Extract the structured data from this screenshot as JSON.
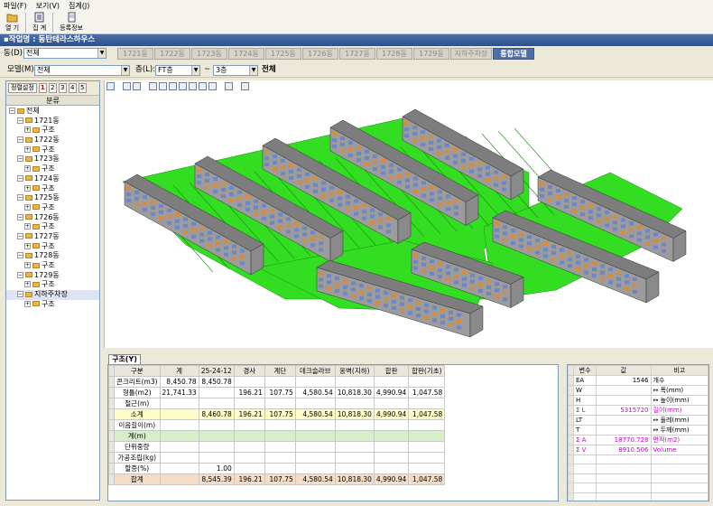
{
  "menu": {
    "file": "파일(F)",
    "view": "보기(V)",
    "sum": "집계(J)"
  },
  "toolbar": {
    "open": "열 기",
    "sum": "집 계",
    "register": "등록정보"
  },
  "title": "▪작업명 : 동탄테라스하우스",
  "dong": {
    "label": "동(D):",
    "value": "전체"
  },
  "tabs": [
    "1721동",
    "1722동",
    "1723동",
    "1724동",
    "1725동",
    "1726동",
    "1727동",
    "1728동",
    "1729동",
    "지하주차장",
    "통합모델"
  ],
  "model": {
    "label": "모델(M):",
    "value": "전체"
  },
  "floor": {
    "label": "층(L):",
    "from": "FT층",
    "tilde": "~",
    "to": "3층",
    "all": "전체"
  },
  "left_panel": {
    "button": "정렬설정",
    "nums": [
      "1",
      "2",
      "3",
      "4",
      "5"
    ],
    "header": "분류",
    "root": "전체",
    "buildings": [
      "1721동",
      "1722동",
      "1723동",
      "1724동",
      "1725동",
      "1726동",
      "1727동",
      "1728동",
      "1729동",
      "지하주차장"
    ],
    "child": "구조"
  },
  "bottom_tab": "구조(Y)",
  "grid": {
    "headers": [
      "구분",
      "계",
      "25-24-12",
      "경사",
      "계단",
      "데크슬라브",
      "옹벽(지하)",
      "합판",
      "합판(기초)"
    ],
    "rows": [
      {
        "cells": [
          "콘크리트(m3)",
          "8,450.78",
          "8,450.78",
          "",
          "",
          "",
          "",
          "",
          ""
        ],
        "cls": ""
      },
      {
        "cells": [
          "형틀(m2)",
          "21,741.33",
          "",
          "196.21",
          "107.75",
          "4,580.54",
          "10,818.30",
          "4,990.94",
          "1,047.58"
        ],
        "cls": ""
      },
      {
        "cells": [
          "철근(m)",
          "",
          "",
          "",
          "",
          "",
          "",
          "",
          ""
        ],
        "cls": ""
      },
      {
        "cells": [
          "소계",
          "",
          "8,460.78",
          "196.21",
          "107.75",
          "4,580.54",
          "10,818.30",
          "4,990.94",
          "1,047.58"
        ],
        "cls": "sub"
      },
      {
        "cells": [
          "이음길이(m)",
          "",
          "",
          "",
          "",
          "",
          "",
          "",
          ""
        ],
        "cls": ""
      },
      {
        "cells": [
          "계(m)",
          "",
          "",
          "",
          "",
          "",
          "",
          "",
          ""
        ],
        "cls": "green"
      },
      {
        "cells": [
          "단위중량",
          "",
          "",
          "",
          "",
          "",
          "",
          "",
          ""
        ],
        "cls": ""
      },
      {
        "cells": [
          "가공조립(kg)",
          "",
          "",
          "",
          "",
          "",
          "",
          "",
          ""
        ],
        "cls": ""
      },
      {
        "cells": [
          "할증(%)",
          "",
          "1.00",
          "",
          "",
          "",
          "",
          "",
          ""
        ],
        "cls": ""
      },
      {
        "cells": [
          "합계",
          "",
          "8,545.39",
          "196.21",
          "107.75",
          "4,580.54",
          "10,818.30",
          "4,990.94",
          "1,047.58"
        ],
        "cls": "tot"
      }
    ]
  },
  "vars": {
    "headers": [
      "변수",
      "값",
      "비고"
    ],
    "rows": [
      {
        "k": "EA",
        "v": "1546",
        "n": "개수",
        "m": false
      },
      {
        "k": "W",
        "v": "",
        "n": "↔ 폭(mm)",
        "m": false
      },
      {
        "k": "H",
        "v": "",
        "n": "↔ 높이(mm)",
        "m": false
      },
      {
        "k": "Σ L",
        "v": "5315720",
        "n": "길이(mm)",
        "m": true
      },
      {
        "k": "LT",
        "v": "",
        "n": "↔ 둘레(mm)",
        "m": false
      },
      {
        "k": "T",
        "v": "",
        "n": "↔ 두께(mm)",
        "m": false
      },
      {
        "k": "Σ A",
        "v": "18770.728",
        "n": "면적(m2)",
        "m": true
      },
      {
        "k": "Σ V",
        "v": "8910.506",
        "n": "Volume",
        "m": true
      },
      {
        "k": "",
        "v": "",
        "n": "",
        "m": false
      },
      {
        "k": "",
        "v": "",
        "n": "",
        "m": false
      },
      {
        "k": "",
        "v": "",
        "n": "",
        "m": false
      },
      {
        "k": "",
        "v": "",
        "n": "",
        "m": false
      },
      {
        "k": "",
        "v": "",
        "n": "",
        "m": false
      }
    ]
  },
  "colors": {
    "title": "#2d4f8a",
    "active_tab": "#4f6fa8",
    "slab": "#33dd22",
    "building": "#a8a8a8",
    "window": "#d98a3a"
  }
}
